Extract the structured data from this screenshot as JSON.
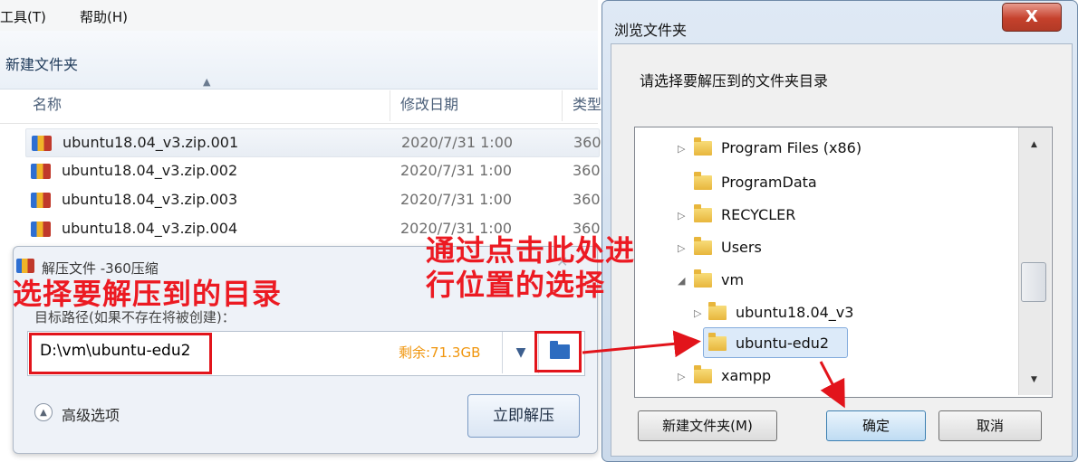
{
  "explorer": {
    "menu": [
      "工具(T)",
      "帮助(H)"
    ],
    "toolbar_new_folder": "新建文件夹",
    "columns": {
      "name": "名称",
      "modified": "修改日期",
      "type": "类型"
    },
    "files": [
      {
        "name": "ubuntu18.04_v3.zip.001",
        "date": "2020/7/31 1:00",
        "type": "360"
      },
      {
        "name": "ubuntu18.04_v3.zip.002",
        "date": "2020/7/31 1:00",
        "type": "360"
      },
      {
        "name": "ubuntu18.04_v3.zip.003",
        "date": "2020/7/31 1:00",
        "type": "360"
      },
      {
        "name": "ubuntu18.04_v3.zip.004",
        "date": "2020/7/31 1:00",
        "type": "360"
      }
    ]
  },
  "extract_dialog": {
    "title": "解压文件 -360压缩",
    "target_label": "目标路径(如果不存在将被创建)：",
    "path_value": "D:\\vm\\ubuntu-edu2",
    "free_space": "剩余:71.3GB",
    "advanced": "高级选项",
    "extract_now": "立即解压"
  },
  "annotations": {
    "choose_dir": "选择要解压到的目录",
    "click_here_line1": "通过点击此处进",
    "click_here_line2": "行位置的选择"
  },
  "browse_dialog": {
    "title": "浏览文件夹",
    "close": "X",
    "prompt": "请选择要解压到的文件夹目录",
    "tree": [
      {
        "label": "Program Files (x86)",
        "expander": "▷"
      },
      {
        "label": "ProgramData",
        "expander": ""
      },
      {
        "label": "RECYCLER",
        "expander": "▷"
      },
      {
        "label": "Users",
        "expander": "▷"
      },
      {
        "label": "vm",
        "expander": "◢"
      },
      {
        "label": "ubuntu18.04_v3",
        "expander": "▷"
      },
      {
        "label": "ubuntu-edu2",
        "expander": "",
        "selected": true
      },
      {
        "label": "xampp",
        "expander": "▷"
      }
    ],
    "new_folder": "新建文件夹(M)",
    "ok": "确定",
    "cancel": "取消"
  },
  "colors": {
    "annotation_red": "#e2141b",
    "free_space_orange": "#f0950c",
    "selection_blue": "#dceaf9"
  }
}
